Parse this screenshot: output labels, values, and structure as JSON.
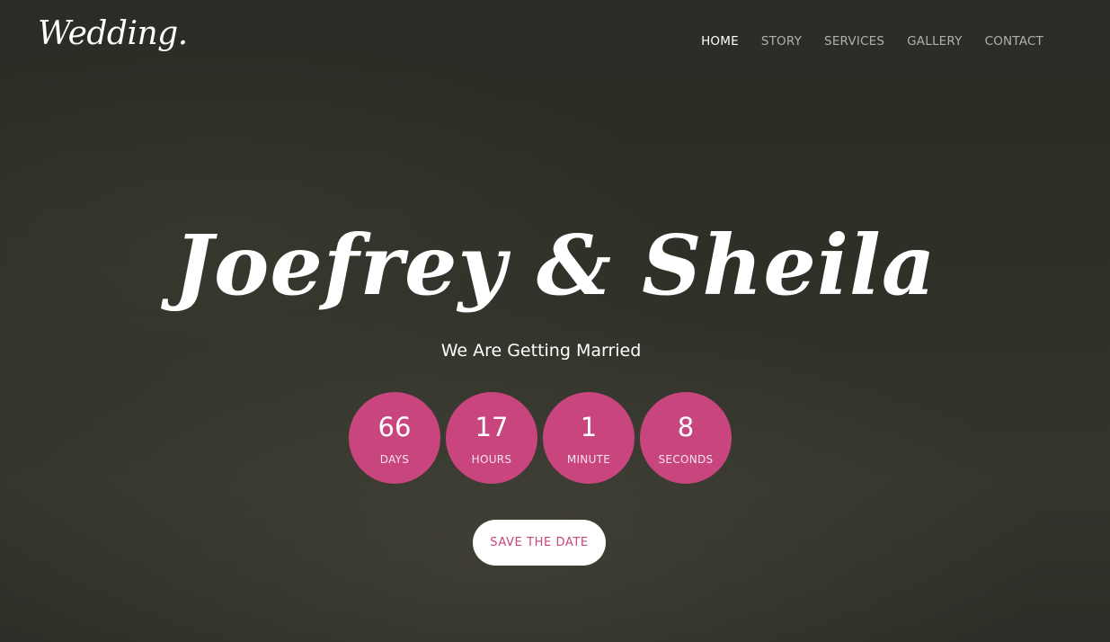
{
  "logo": {
    "text": "Wedding."
  },
  "nav": {
    "items": [
      {
        "label": "HOME",
        "active": true
      },
      {
        "label": "STORY",
        "active": false
      },
      {
        "label": "SERVICES",
        "active": false
      },
      {
        "label": "GALLERY",
        "active": false
      },
      {
        "label": "CONTACT",
        "active": false
      }
    ]
  },
  "hero": {
    "couple": "Joefrey & Sheila",
    "tagline": "We Are Getting Married",
    "countdown": [
      {
        "value": "66",
        "label": "DAYS"
      },
      {
        "value": "17",
        "label": "HOURS"
      },
      {
        "value": "1",
        "label": "MINUTE"
      },
      {
        "value": "8",
        "label": "SECONDS"
      }
    ],
    "save_button": "SAVE THE DATE"
  },
  "colors": {
    "accent": "#c8457e",
    "background": "#2f3128",
    "text": "#ffffff"
  }
}
